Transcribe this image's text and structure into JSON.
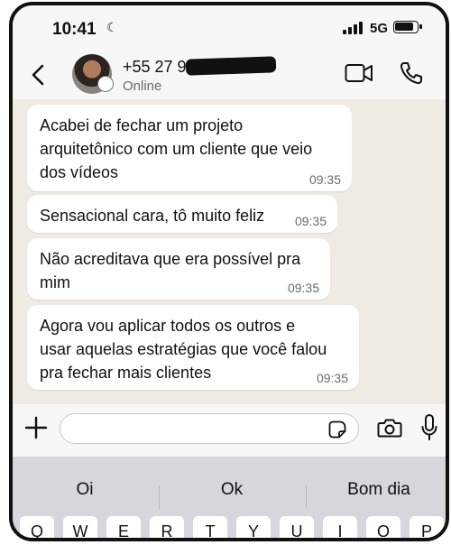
{
  "status_bar": {
    "time": "10:41",
    "network": "5G",
    "moon_icon": "moon-icon"
  },
  "header": {
    "contact_name": "+55 27 99",
    "status": "Online"
  },
  "messages": [
    {
      "lines": [
        "Acabei de fechar um projeto",
        "arquitetônico com um cliente que veio",
        "dos vídeos"
      ],
      "time": "09:35"
    },
    {
      "lines": [
        "Sensacional cara, tô muito feliz"
      ],
      "time": "09:35"
    },
    {
      "lines": [
        "Não acreditava que era possível pra",
        "mim"
      ],
      "time": "09:35"
    },
    {
      "lines": [
        "Agora vou aplicar todos os outros e",
        "usar aquelas estratégias que você falou",
        "pra fechar mais clientes"
      ],
      "time": "09:35"
    }
  ],
  "composer": {
    "value": "",
    "placeholder": ""
  },
  "keyboard": {
    "suggestions": [
      "Oi",
      "Ok",
      "Bom dia"
    ],
    "keys": [
      "Q",
      "W",
      "E",
      "R",
      "T",
      "Y",
      "U",
      "I",
      "O",
      "P"
    ]
  },
  "colors": {
    "chat_background": "#efeae2",
    "bubble": "#ffffff",
    "bar": "#f7f7f7",
    "keyboard": "#d5d7dd"
  }
}
